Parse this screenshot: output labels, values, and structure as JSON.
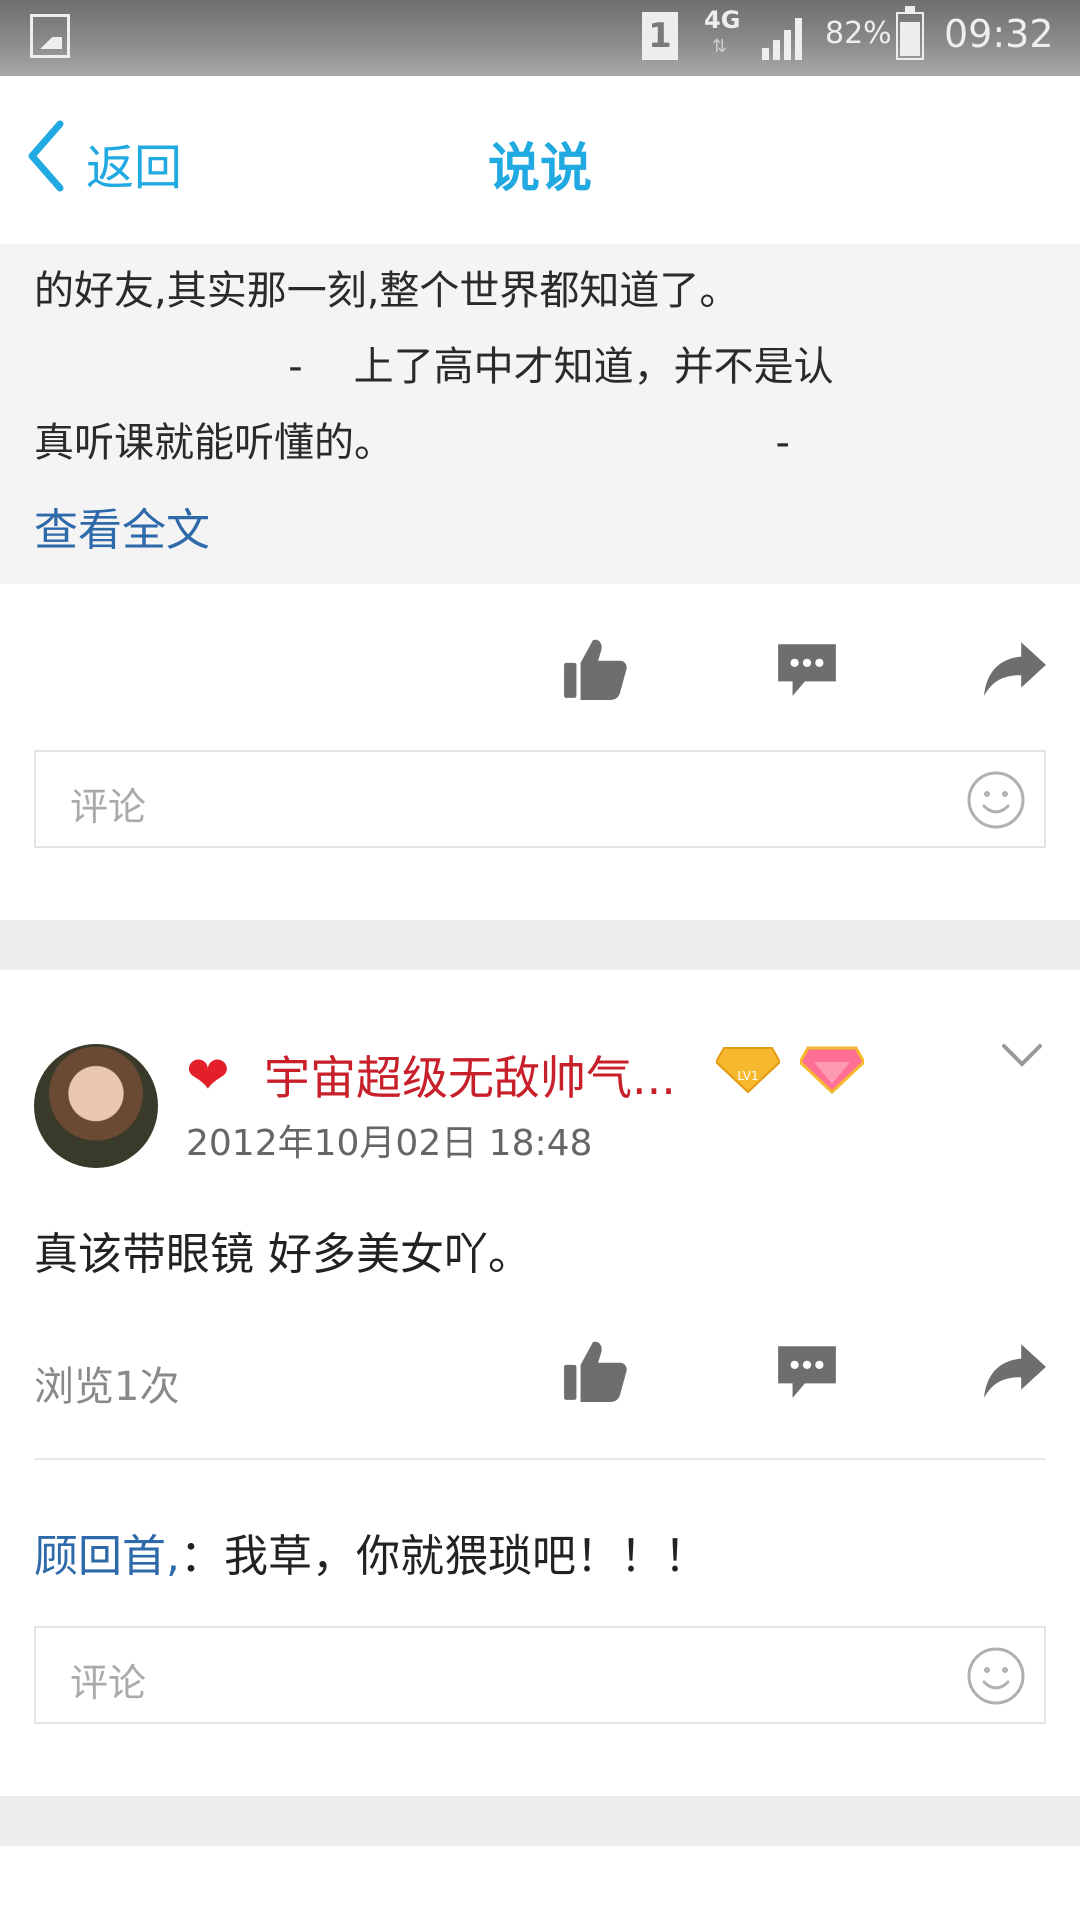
{
  "status_bar": {
    "sim": "1",
    "network": "4G",
    "network_arrows": "⇅",
    "battery_percent": "82%",
    "time": "09:32"
  },
  "header": {
    "back_label": "返回",
    "title": "说说"
  },
  "post1": {
    "quote_lines": [
      "的好友,其实那一刻,整个世界都知道了。",
      "                    -    上了高中才知道，并不是认",
      "真听课就能听懂的。                              -"
    ],
    "view_full": "查看全文",
    "comment_placeholder": "评论"
  },
  "post2": {
    "username": "宇宙超级无敌帅气...",
    "badge_level": "LV1",
    "timestamp": "2012年10月02日 18:48",
    "text": "真该带眼镜  好多美女吖。",
    "views": "浏览1次",
    "reply_name": "顾回首,",
    "reply_text": "：我草，你就猥琐吧！！！",
    "comment_placeholder": "评论"
  },
  "colors": {
    "accent": "#21a9e1",
    "link": "#2e69a9",
    "username": "#c8202a",
    "icon_gray": "#6e6e6e"
  }
}
